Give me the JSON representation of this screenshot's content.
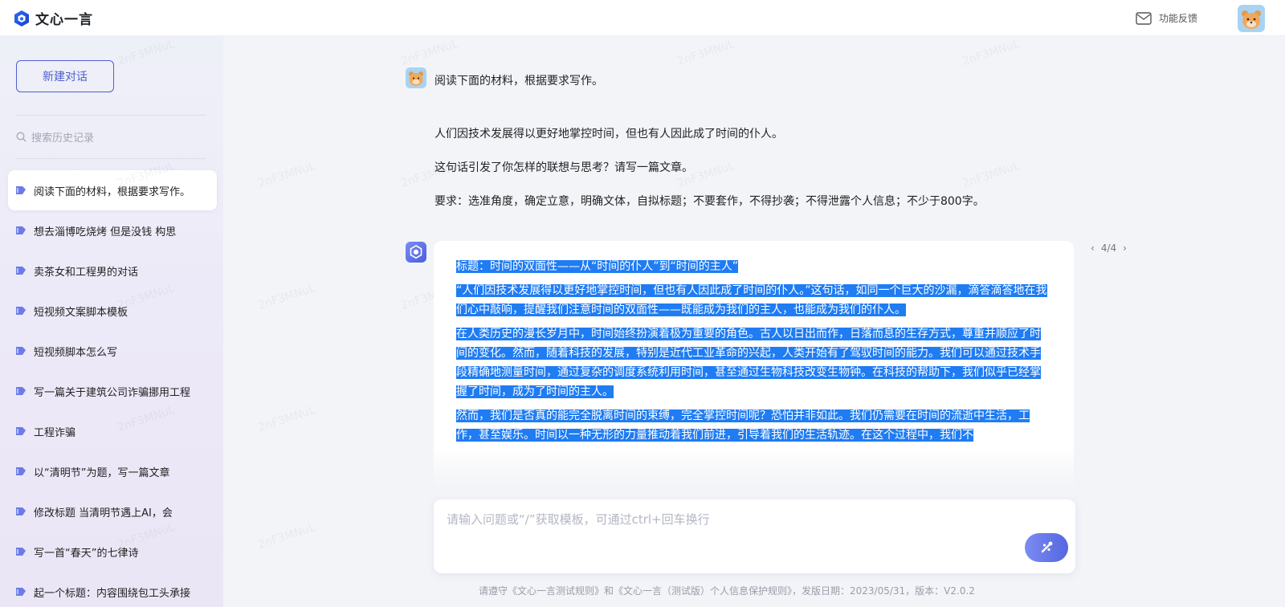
{
  "app": {
    "brand": "文心一言",
    "feedback_label": "功能反馈"
  },
  "sidebar": {
    "new_chat_label": "新建对话",
    "search_placeholder": "搜索历史记录",
    "items": [
      {
        "label": "阅读下面的材料，根据要求写作。"
      },
      {
        "label": "想去淄博吃烧烤 但是没钱 构思"
      },
      {
        "label": "卖茶女和工程男的对话"
      },
      {
        "label": "短视频文案脚本模板"
      },
      {
        "label": "短视频脚本怎么写"
      },
      {
        "label": "写一篇关于建筑公司诈骗挪用工程"
      },
      {
        "label": "工程诈骗"
      },
      {
        "label": "以“清明节”为题，写一篇文章"
      },
      {
        "label": "修改标题 当清明节遇上AI，会"
      },
      {
        "label": "写一首“春天”的七律诗"
      },
      {
        "label": "起一个标题：内容围绕包工头承接"
      }
    ]
  },
  "conversation": {
    "user_lines": [
      "阅读下面的材料，根据要求写作。",
      "人们因技术发展得以更好地掌控时间，但也有人因此成了时间的仆人。",
      "这句话引发了你怎样的联想与思考？请写一篇文章。",
      "要求：选准角度，确定立意，明确文体，自拟标题；不要套作，不得抄袭；不得泄露个人信息；不少于800字。"
    ],
    "pager": "4/4",
    "answer": [
      "标题：时间的双面性——从“时间的仆人”到“时间的主人”",
      "“人们因技术发展得以更好地掌控时间，但也有人因此成了时间的仆人。”这句话，如同一个巨大的沙漏，滴答滴答地在我们心中敲响，提醒我们注意时间的双面性——既能成为我们的主人，也能成为我们的仆人。",
      "在人类历史的漫长岁月中，时间始终扮演着极为重要的角色。古人以日出而作，日落而息的生存方式，尊重并顺应了时间的变化。然而，随着科技的发展，特别是近代工业革命的兴起，人类开始有了驾驭时间的能力。我们可以通过技术手段精确地测量时间，通过复杂的调度系统利用时间，甚至通过生物科技改变生物钟。在科技的帮助下，我们似乎已经掌握了时间，成为了时间的主人。",
      "然而，我们是否真的能完全脱离时间的束缚，完全掌控时间呢？恐怕并非如此。我们仍需要在时间的流逝中生活，工作，甚至娱乐。时间以一种无形的力量推动着我们前进，引导着我们的生活轨迹。在这个过程中，我们不"
    ]
  },
  "input": {
    "placeholder": "请输入问题或“/”获取模板，可通过ctrl+回车换行"
  },
  "footer": {
    "text": "请遵守《文心一言测试规则》和《文心一言（测试版）个人信息保护规则》，发版日期：2023/05/31，版本：V2.0.2"
  },
  "watermark": "2nF3MNuL",
  "colors": {
    "accent": "#4e5fcf",
    "selection": "#1f7cf3",
    "send_gradient_start": "#7b8cf3",
    "send_gradient_end": "#5566e0"
  }
}
